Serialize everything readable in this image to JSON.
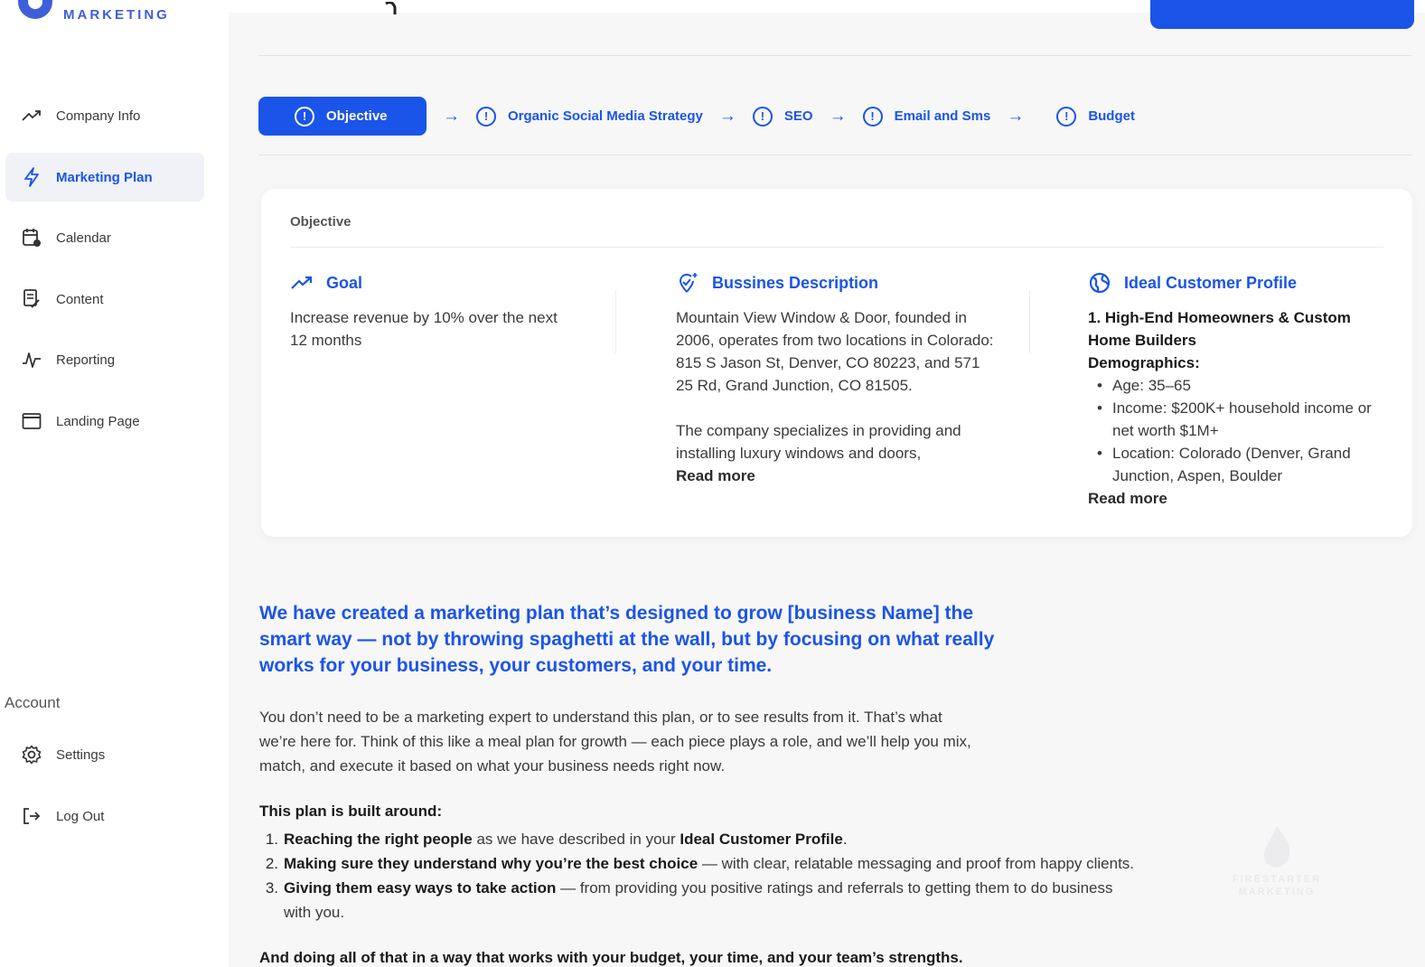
{
  "brand": {
    "name": "MARKETING"
  },
  "sidebar": {
    "items": [
      {
        "label": "Company Info",
        "icon": "trending-up-icon"
      },
      {
        "label": "Marketing Plan",
        "icon": "lightning-icon",
        "active": true
      },
      {
        "label": "Calendar",
        "icon": "calendar-icon"
      },
      {
        "label": "Content",
        "icon": "document-edit-icon"
      },
      {
        "label": "Reporting",
        "icon": "pulse-icon"
      },
      {
        "label": "Landing Page",
        "icon": "browser-window-icon"
      }
    ],
    "account_label": "Account",
    "account_items": [
      {
        "label": "Settings",
        "icon": "gear-icon"
      },
      {
        "label": "Log Out",
        "icon": "logout-icon"
      }
    ]
  },
  "stepper": {
    "steps": [
      {
        "label": "Objective",
        "active": true
      },
      {
        "label": "Organic Social Media Strategy"
      },
      {
        "label": "SEO"
      },
      {
        "label": "Email and Sms"
      },
      {
        "label": "Budget"
      }
    ]
  },
  "objective_card": {
    "title": "Objective",
    "goal": {
      "heading": "Goal",
      "text": "Increase revenue by 10% over the next 12 months"
    },
    "business": {
      "heading": "Bussines Description",
      "text1": "Mountain View Window & Door, founded in 2006, operates from two locations in Colorado: 815 S Jason St, Denver, CO 80223, and 571 25 Rd, Grand Junction, CO 81505.",
      "text2": "The company specializes in providing and installing luxury windows and doors,",
      "read_more": "Read more"
    },
    "icp": {
      "heading": "Ideal Customer Profile",
      "segment": "1. High-End Homeowners & Custom Home Builders",
      "demographics_label": "Demographics:",
      "bullets": [
        "Age: 35–65",
        "Income: $200K+ household income or net worth $1M+",
        "Location: Colorado (Denver, Grand Junction, Aspen, Boulder"
      ],
      "read_more": "Read more"
    }
  },
  "body": {
    "lead": "We have created a marketing plan that’s designed to grow [business Name] the smart way — not by throwing spaghetti at the wall, but by focusing on what really works for your business, your customers, and your time.",
    "para": "You don’t need to be a marketing expert to understand this plan, or to see results from it. That’s what we’re here for. Think of this like a meal plan for growth — each piece plays a role, and we’ll help you mix, match, and execute it based on what your business needs right now.",
    "built_label": "This plan is built around:",
    "points": [
      {
        "num": "1.",
        "bold": "Reaching the right people",
        "rest": " as we have described in your ",
        "bold2": "Ideal Customer Profile",
        "rest2": "."
      },
      {
        "num": "2.",
        "bold": "Making sure they understand why you’re the best choice",
        "rest": " — with clear, relatable messaging and proof from happy clients.",
        "bold2": "",
        "rest2": ""
      },
      {
        "num": "3.",
        "bold": "Giving them easy ways to take action",
        "rest": " — from providing you positive ratings and referrals to getting them to do business with you.",
        "bold2": "",
        "rest2": ""
      }
    ],
    "tail": "And doing all of that in a way that works with your budget, your time, and your team’s strengths."
  },
  "watermark": {
    "line1": "FIRESTARTER",
    "line2": "MARKETING"
  },
  "colors": {
    "accent": "#1b54e8",
    "sidebar_active_bg": "#f0f2f8",
    "page_bg": "#f7f7f8"
  }
}
